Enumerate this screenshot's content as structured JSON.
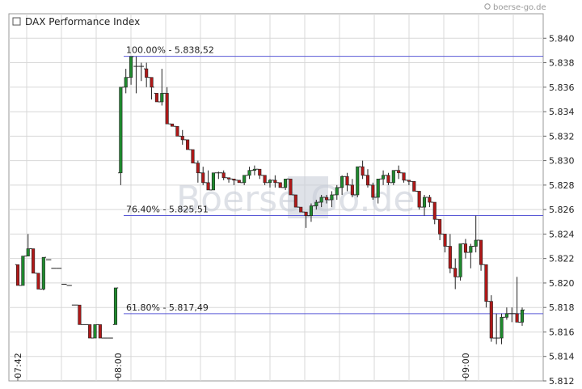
{
  "header": {
    "title": "DAX Performance Index",
    "watermark_text": "boerse-go.de",
    "watermark_logo": "Boerse Go.de"
  },
  "colors": {
    "up": "#1f8a2e",
    "down": "#b01818",
    "fib": "#5a5ad6",
    "grid": "#d8d8d8",
    "frame": "#999999"
  },
  "chart_data": {
    "type": "candlestick",
    "title": "DAX Performance Index",
    "y_range": [
      5.812,
      5.842
    ],
    "y_ticks": [
      "5.840",
      "5.838",
      "5.836",
      "5.834",
      "5.832",
      "5.830",
      "5.828",
      "5.826",
      "5.824",
      "5.822",
      "5.820",
      "5.818",
      "5.816",
      "5.814",
      "5.812"
    ],
    "x_ticks": [
      "07:42",
      "08:00",
      "09:00"
    ],
    "grid": true,
    "fib_levels": [
      {
        "label": "100.00% - 5.838,52",
        "value": 5.83852
      },
      {
        "label": "76.40% - 5.825,51",
        "value": 5.82551
      },
      {
        "label": "61.80% - 5.817,49",
        "value": 5.81749
      }
    ],
    "candles": [
      [
        5.8215,
        5.8215,
        5.8198,
        5.8198
      ],
      [
        5.8198,
        5.8222,
        5.8198,
        5.8222
      ],
      [
        5.8222,
        5.824,
        5.8222,
        5.8228
      ],
      [
        5.8228,
        5.8228,
        5.8208,
        5.8208
      ],
      [
        5.8208,
        5.8208,
        5.8195,
        5.8195
      ],
      [
        5.8195,
        5.8221,
        5.8194,
        5.8221
      ],
      [
        5.8219,
        5.8219,
        5.8219,
        5.8219
      ],
      [
        5.8212,
        5.8212,
        5.8212,
        5.8212
      ],
      [
        5.8212,
        5.8212,
        5.8212,
        5.8212
      ],
      [
        5.8199,
        5.8199,
        5.8199,
        5.8199
      ],
      [
        5.8198,
        5.8198,
        5.8198,
        5.8198
      ],
      [
        5.8182,
        5.8182,
        5.8182,
        5.8182
      ],
      [
        5.8182,
        5.8182,
        5.8166,
        5.8166
      ],
      [
        5.8166,
        5.8166,
        5.8166,
        5.8166
      ],
      [
        5.8166,
        5.8166,
        5.8155,
        5.8155
      ],
      [
        5.8155,
        5.8166,
        5.8155,
        5.8166
      ],
      [
        5.8166,
        5.8166,
        5.8155,
        5.8155
      ],
      [
        5.8155,
        5.8155,
        5.8155,
        5.8155
      ],
      [
        5.8155,
        5.8155,
        5.8155,
        5.8155
      ],
      [
        5.8166,
        5.8196,
        5.8166,
        5.8196
      ],
      [
        5.829,
        5.836,
        5.828,
        5.836
      ],
      [
        5.836,
        5.8375,
        5.8355,
        5.8368
      ],
      [
        5.8368,
        5.8385,
        5.8362,
        5.8385
      ],
      [
        5.8377,
        5.8385,
        5.8355,
        5.8377
      ],
      [
        5.8377,
        5.838,
        5.8365,
        5.8377
      ],
      [
        5.8375,
        5.838,
        5.836,
        5.8368
      ],
      [
        5.8368,
        5.8368,
        5.835,
        5.836
      ],
      [
        5.8355,
        5.8355,
        5.8348,
        5.8348
      ],
      [
        5.8348,
        5.8375,
        5.8345,
        5.8355
      ],
      [
        5.8355,
        5.836,
        5.833,
        5.833
      ],
      [
        5.833,
        5.833,
        5.8328,
        5.8328
      ],
      [
        5.8328,
        5.8328,
        5.832,
        5.832
      ],
      [
        5.832,
        5.8325,
        5.8313,
        5.8317
      ],
      [
        5.8317,
        5.8317,
        5.8309,
        5.8309
      ],
      [
        5.8309,
        5.8309,
        5.8298,
        5.8298
      ],
      [
        5.8298,
        5.83,
        5.8282,
        5.829
      ],
      [
        5.829,
        5.8295,
        5.828,
        5.8282
      ],
      [
        5.8282,
        5.8292,
        5.8276,
        5.8276
      ],
      [
        5.8276,
        5.829,
        5.8276,
        5.829
      ],
      [
        5.829,
        5.8291,
        5.8285,
        5.829
      ],
      [
        5.829,
        5.8292,
        5.8284,
        5.8286
      ],
      [
        5.8286,
        5.8286,
        5.8282,
        5.8285
      ],
      [
        5.8285,
        5.8285,
        5.828,
        5.8284
      ],
      [
        5.8284,
        5.8284,
        5.8282,
        5.8282
      ],
      [
        5.8282,
        5.8288,
        5.828,
        5.8288
      ],
      [
        5.8288,
        5.8295,
        5.8285,
        5.8292
      ],
      [
        5.8292,
        5.8296,
        5.8288,
        5.8293
      ],
      [
        5.8293,
        5.8293,
        5.8285,
        5.8288
      ],
      [
        5.8288,
        5.8288,
        5.828,
        5.8282
      ],
      [
        5.8282,
        5.8285,
        5.8278,
        5.8284
      ],
      [
        5.8284,
        5.8288,
        5.8278,
        5.8282
      ],
      [
        5.8282,
        5.8282,
        5.8278,
        5.8278
      ],
      [
        5.8278,
        5.8285,
        5.8276,
        5.8285
      ],
      [
        5.8285,
        5.8285,
        5.8272,
        5.8272
      ],
      [
        5.8272,
        5.8272,
        5.8262,
        5.8262
      ],
      [
        5.8262,
        5.8262,
        5.8258,
        5.8258
      ],
      [
        5.8258,
        5.8258,
        5.8245,
        5.8255
      ],
      [
        5.8255,
        5.8265,
        5.825,
        5.8263
      ],
      [
        5.8263,
        5.8268,
        5.826,
        5.8266
      ],
      [
        5.8266,
        5.8272,
        5.8262,
        5.827
      ],
      [
        5.827,
        5.8272,
        5.8265,
        5.8268
      ],
      [
        5.8268,
        5.8275,
        5.8262,
        5.8272
      ],
      [
        5.8272,
        5.828,
        5.8268,
        5.8278
      ],
      [
        5.8278,
        5.8288,
        5.8272,
        5.8287
      ],
      [
        5.8287,
        5.829,
        5.8275,
        5.828
      ],
      [
        5.828,
        5.8285,
        5.827,
        5.8272
      ],
      [
        5.8272,
        5.8295,
        5.827,
        5.8295
      ],
      [
        5.8295,
        5.83,
        5.8285,
        5.8288
      ],
      [
        5.8288,
        5.8293,
        5.8278,
        5.828
      ],
      [
        5.828,
        5.8282,
        5.8268,
        5.827
      ],
      [
        5.827,
        5.8285,
        5.8265,
        5.8285
      ],
      [
        5.8285,
        5.8292,
        5.828,
        5.8288
      ],
      [
        5.8288,
        5.829,
        5.828,
        5.8282
      ],
      [
        5.8282,
        5.8292,
        5.828,
        5.8292
      ],
      [
        5.8292,
        5.8296,
        5.8285,
        5.829
      ],
      [
        5.829,
        5.829,
        5.8282,
        5.8284
      ],
      [
        5.8284,
        5.8284,
        5.828,
        5.8283
      ],
      [
        5.8283,
        5.8283,
        5.8275,
        5.8275
      ],
      [
        5.8275,
        5.8275,
        5.826,
        5.8262
      ],
      [
        5.8262,
        5.8272,
        5.8255,
        5.827
      ],
      [
        5.827,
        5.8272,
        5.8262,
        5.8266
      ],
      [
        5.8266,
        5.8266,
        5.8248,
        5.8252
      ],
      [
        5.8252,
        5.8252,
        5.8235,
        5.824
      ],
      [
        5.824,
        5.824,
        5.8225,
        5.823
      ],
      [
        5.823,
        5.824,
        5.8208,
        5.8212
      ],
      [
        5.8212,
        5.822,
        5.8195,
        5.8205
      ],
      [
        5.8205,
        5.8232,
        5.8202,
        5.8232
      ],
      [
        5.8232,
        5.8236,
        5.822,
        5.8225
      ],
      [
        5.8225,
        5.8232,
        5.8212,
        5.823
      ],
      [
        5.823,
        5.8255,
        5.8225,
        5.8235
      ],
      [
        5.8235,
        5.8235,
        5.821,
        5.8215
      ],
      [
        5.8215,
        5.8215,
        5.818,
        5.8185
      ],
      [
        5.8185,
        5.819,
        5.8152,
        5.8155
      ],
      [
        5.8155,
        5.8175,
        5.815,
        5.8155
      ],
      [
        5.8155,
        5.8175,
        5.815,
        5.8172
      ],
      [
        5.8172,
        5.818,
        5.817,
        5.8175
      ],
      [
        5.8175,
        5.818,
        5.8168,
        5.8175
      ],
      [
        5.8175,
        5.8205,
        5.8168,
        5.8168
      ],
      [
        5.8168,
        5.818,
        5.8165,
        5.8178
      ]
    ]
  }
}
